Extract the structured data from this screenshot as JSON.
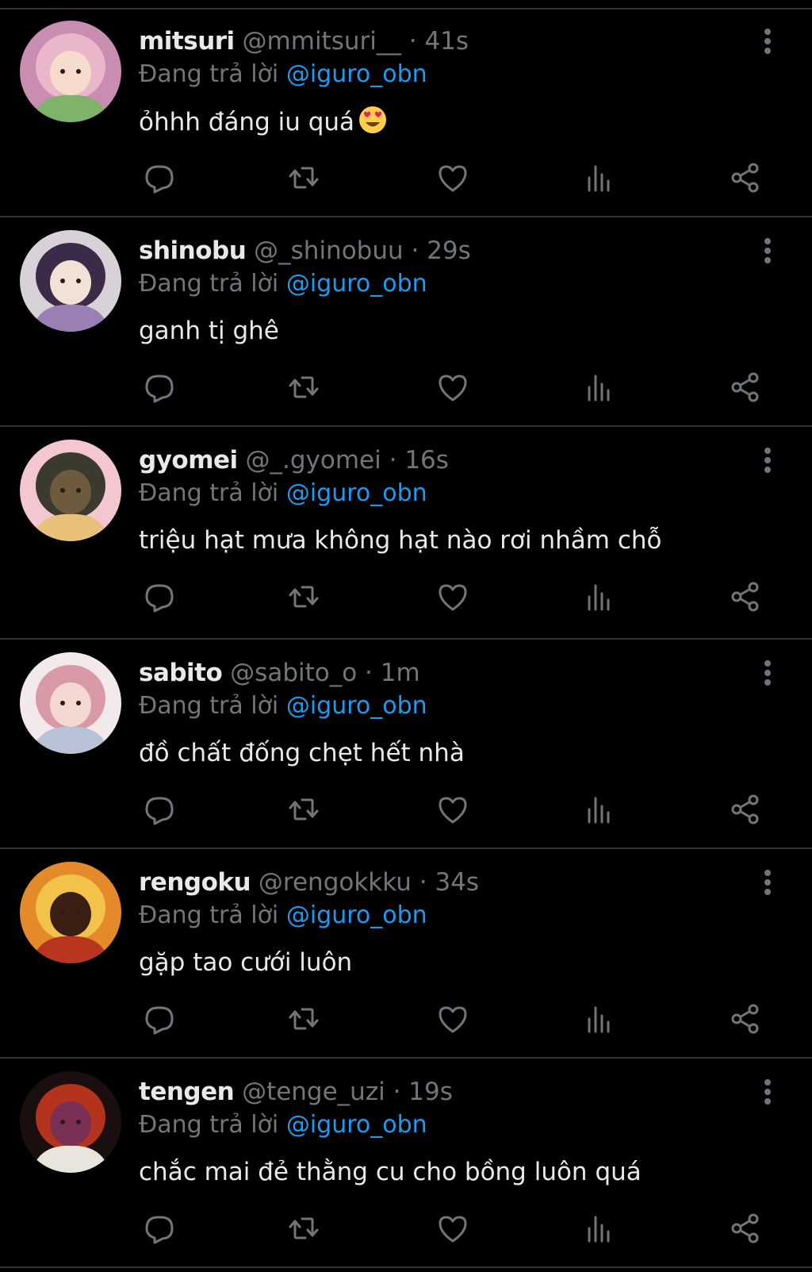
{
  "replies": [
    {
      "name": "mitsuri",
      "handle": "@mmitsuri__",
      "time": "41s",
      "reply_prefix": "Đang trả lời",
      "reply_to": "@iguro_obn",
      "text": "ỏhhh đáng iu quá",
      "emoji": "smiling-face-with-heart-eyes-icon",
      "avatar_colors": [
        "#c88db0",
        "#e9b7c9",
        "#7fb36a",
        "#f5dccc"
      ]
    },
    {
      "name": "shinobu",
      "handle": "@_shinobuu",
      "time": "29s",
      "reply_prefix": "Đang trả lời",
      "reply_to": "@iguro_obn",
      "text": "ganh tị ghê",
      "avatar_colors": [
        "#d8d2d8",
        "#3b2b48",
        "#9a7fb5",
        "#f2e1d6"
      ]
    },
    {
      "name": "gyomei",
      "handle": "@_.gyomei",
      "time": "16s",
      "reply_prefix": "Đang trả lời",
      "reply_to": "@iguro_obn",
      "text": "triệu hạt mưa không hạt nào rơi nhầm chỗ",
      "avatar_colors": [
        "#f4c6cf",
        "#3a3a2e",
        "#e8c07a",
        "#6e5a3c"
      ]
    },
    {
      "name": "sabito",
      "handle": "@sabito_o",
      "time": "1m",
      "reply_prefix": "Đang trả lời",
      "reply_to": "@iguro_obn",
      "text": "đồ chất đống chẹt hết nhà",
      "avatar_colors": [
        "#f1e9ea",
        "#d79aa6",
        "#b9c3d8",
        "#f3d9d2"
      ]
    },
    {
      "name": "rengoku",
      "handle": "@rengokkku",
      "time": "34s",
      "reply_prefix": "Đang trả lời",
      "reply_to": "@iguro_obn",
      "text": "gặp tao cưới luôn",
      "avatar_colors": [
        "#e58a2b",
        "#f3c24a",
        "#b8351f",
        "#3b1f14"
      ]
    },
    {
      "name": "tengen",
      "handle": "@tenge_uzi",
      "time": "19s",
      "reply_prefix": "Đang trả lời",
      "reply_to": "@iguro_obn",
      "text": "chắc mai đẻ thằng cu cho bồng luôn quá",
      "avatar_colors": [
        "#1b0e0e",
        "#b3331c",
        "#e9e4de",
        "#7a2f55"
      ]
    }
  ],
  "icons": {
    "reply": "reply-icon",
    "retweet": "retweet-icon",
    "like": "like-icon",
    "views": "views-icon",
    "share": "share-icon",
    "more": "more-icon"
  },
  "colors": {
    "background": "#000000",
    "text": "#e7e9ea",
    "secondary": "#71767b",
    "mention": "#1d9bf0",
    "divider": "#2f3336"
  }
}
